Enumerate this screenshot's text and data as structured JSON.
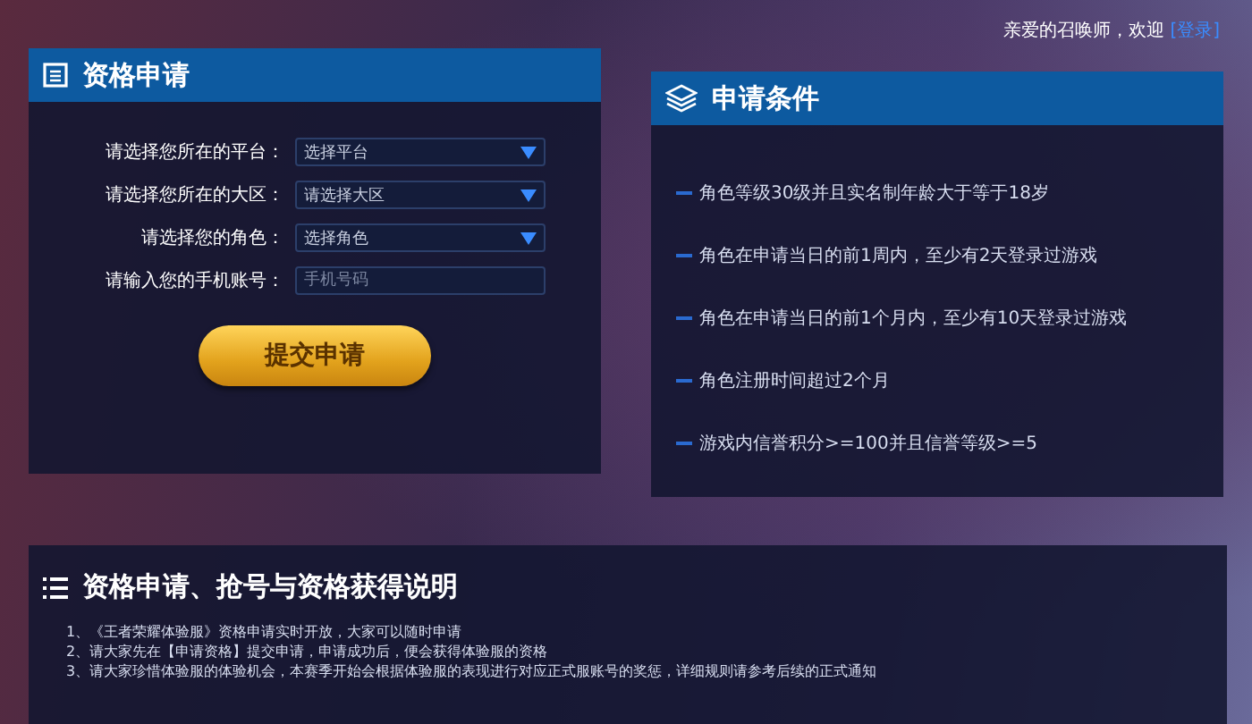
{
  "header": {
    "greeting": "亲爱的召唤师，欢迎",
    "login_link": "[登录]"
  },
  "application_panel": {
    "title": "资格申请",
    "fields": [
      {
        "kind": "select",
        "label": "请选择您所在的平台：",
        "value": "选择平台"
      },
      {
        "kind": "select",
        "label": "请选择您所在的大区：",
        "value": "请选择大区"
      },
      {
        "kind": "select",
        "label": "请选择您的角色：",
        "value": "选择角色"
      },
      {
        "kind": "input",
        "label": "请输入您的手机账号：",
        "placeholder": "手机号码"
      }
    ],
    "submit_button": "提交申请"
  },
  "conditions_panel": {
    "title": "申请条件",
    "items": [
      "角色等级30级并且实名制年龄大于等于18岁",
      "角色在申请当日的前1周内，至少有2天登录过游戏",
      "角色在申请当日的前1个月内，至少有10天登录过游戏",
      "角色注册时间超过2个月",
      "游戏内信誉积分>=100并且信誉等级>=5"
    ]
  },
  "notes_panel": {
    "title": "资格申请、抢号与资格获得说明",
    "items": [
      "1、《王者荣耀体验服》资格申请实时开放，大家可以随时申请",
      "2、请大家先在【申请资格】提交申请，申请成功后，便会获得体验服的资格",
      "3、请大家珍惜体验服的体验机会，本赛季开始会根据体验服的表现进行对应正式服账号的奖惩，详细规则请参考后续的正式通知"
    ]
  }
}
